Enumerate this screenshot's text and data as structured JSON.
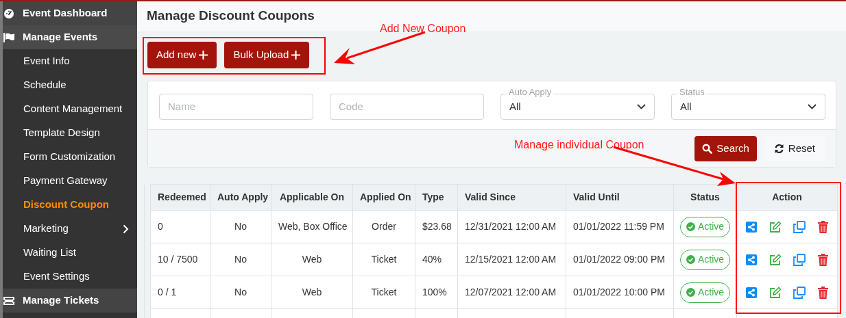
{
  "sidebar": {
    "items": [
      {
        "label": "Event Dashboard"
      },
      {
        "label": "Manage Events",
        "children": [
          {
            "label": "Event Info",
            "selected": false,
            "has_submenu": false
          },
          {
            "label": "Schedule",
            "selected": false,
            "has_submenu": false
          },
          {
            "label": "Content Management",
            "selected": false,
            "has_submenu": false
          },
          {
            "label": "Template Design",
            "selected": false,
            "has_submenu": false
          },
          {
            "label": "Form Customization",
            "selected": false,
            "has_submenu": false
          },
          {
            "label": "Payment Gateway",
            "selected": false,
            "has_submenu": false
          },
          {
            "label": "Discount Coupon",
            "selected": true,
            "has_submenu": false
          },
          {
            "label": "Marketing",
            "selected": false,
            "has_submenu": true
          },
          {
            "label": "Waiting List",
            "selected": false,
            "has_submenu": false
          },
          {
            "label": "Event Settings",
            "selected": false,
            "has_submenu": false
          }
        ]
      },
      {
        "label": "Manage Tickets"
      }
    ]
  },
  "page_title": "Manage Discount Coupons",
  "toolbar": {
    "buttons": [
      "Add new",
      "Bulk Upload"
    ]
  },
  "filters": {
    "fields": [
      {
        "kind": "input",
        "placeholder": "Name"
      },
      {
        "kind": "input",
        "placeholder": "Code"
      },
      {
        "kind": "select",
        "label": "Auto Apply",
        "value": "All"
      },
      {
        "kind": "select",
        "label": "Status",
        "value": "All"
      }
    ],
    "search_button": "Search",
    "reset_button": "Reset"
  },
  "table": {
    "columns": [
      "Redeemed",
      "Auto Apply",
      "Applicable On",
      "Applied On",
      "Type",
      "Valid Since",
      "Valid Until",
      "Status",
      "Action"
    ],
    "rows": [
      {
        "cells": [
          "0",
          "No",
          "Web, Box Office",
          "Order",
          "$23.68",
          "12/31/2021 12:00 AM",
          "01/01/2022 11:59 PM"
        ],
        "status": "Active"
      },
      {
        "cells": [
          "10 / 7500",
          "No",
          "Web",
          "Ticket",
          "40%",
          "12/15/2021 12:00 AM",
          "01/01/2022 09:00 PM"
        ],
        "status": "Active"
      },
      {
        "cells": [
          "0 / 1",
          "No",
          "Web",
          "Ticket",
          "100%",
          "12/07/2021 12:00 AM",
          "01/01/2022 10:00 PM"
        ],
        "status": "Active"
      }
    ]
  },
  "annotations": [
    {
      "text": "Add New Coupon"
    },
    {
      "text": "Manage individual Coupon"
    }
  ]
}
